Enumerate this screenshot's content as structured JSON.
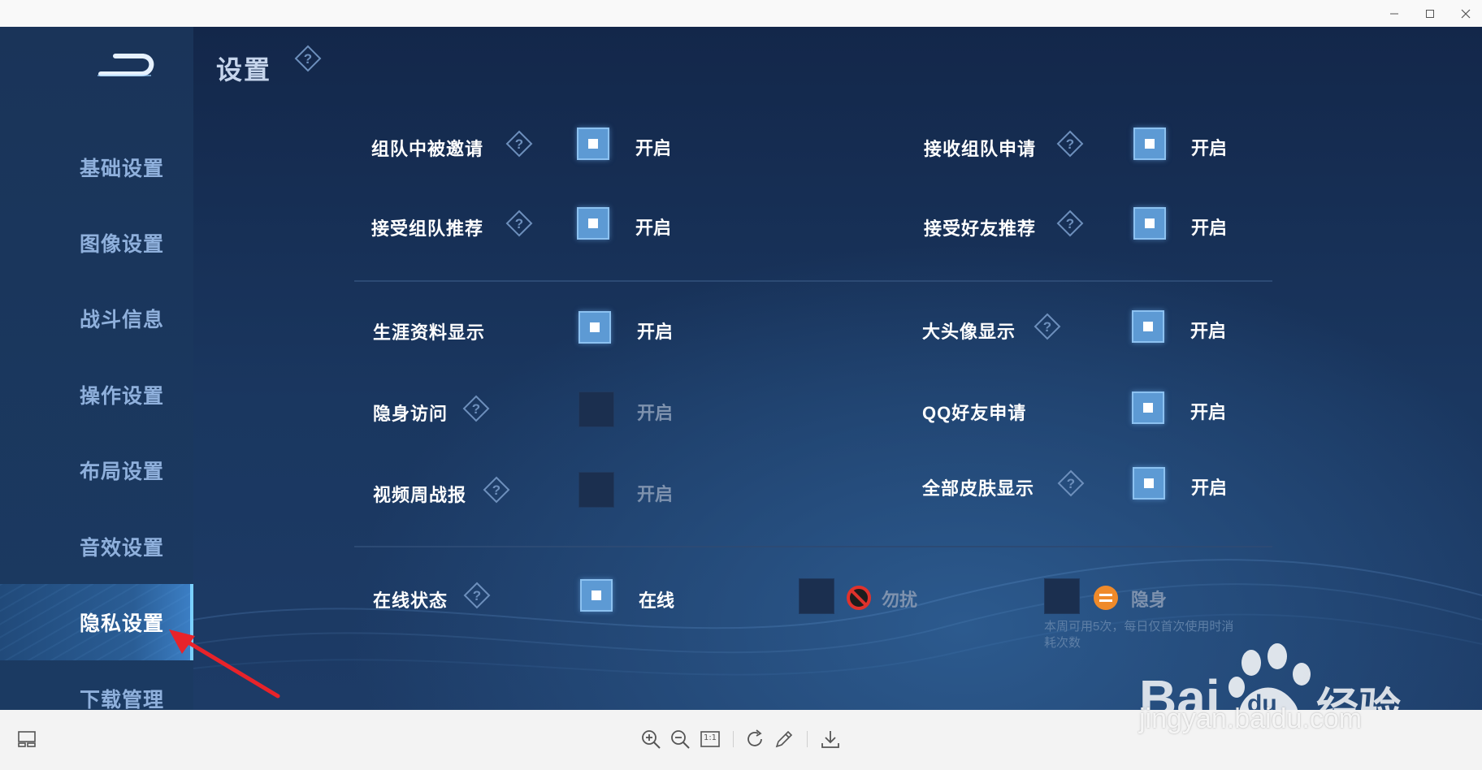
{
  "window": {
    "controls": [
      "minimize-icon",
      "maximize-icon",
      "close-icon"
    ]
  },
  "sidebar": {
    "back_icon": "back-icon",
    "items": [
      {
        "label": "基础设置",
        "active": false
      },
      {
        "label": "图像设置",
        "active": false
      },
      {
        "label": "战斗信息",
        "active": false
      },
      {
        "label": "操作设置",
        "active": false
      },
      {
        "label": "布局设置",
        "active": false
      },
      {
        "label": "音效设置",
        "active": false
      },
      {
        "label": "隐私设置",
        "active": true
      },
      {
        "label": "下载管理",
        "active": false
      }
    ]
  },
  "page": {
    "title": "设置"
  },
  "settings": {
    "team_invited": {
      "label": "组队中被邀请",
      "option": "开启",
      "checked": true
    },
    "receive_team_apply": {
      "label": "接收组队申请",
      "option": "开启",
      "checked": true
    },
    "accept_team_recommend": {
      "label": "接受组队推荐",
      "option": "开启",
      "checked": true
    },
    "accept_friend_recommend": {
      "label": "接受好友推荐",
      "option": "开启",
      "checked": true
    },
    "career_display": {
      "label": "生涯资料显示",
      "option": "开启",
      "checked": true
    },
    "big_avatar_display": {
      "label": "大头像显示",
      "option": "开启",
      "checked": true
    },
    "stealth_visit": {
      "label": "隐身访问",
      "option": "开启",
      "checked": false
    },
    "qq_friend_apply": {
      "label": "QQ好友申请",
      "option": "开启",
      "checked": true
    },
    "video_weekly_report": {
      "label": "视频周战报",
      "option": "开启",
      "checked": false
    },
    "all_skins_display": {
      "label": "全部皮肤显示",
      "option": "开启",
      "checked": true
    }
  },
  "online_status": {
    "label": "在线状态",
    "options": [
      {
        "label": "在线",
        "checked": true,
        "icon": ""
      },
      {
        "label": "勿扰",
        "checked": false,
        "icon": "no-disturb-icon"
      },
      {
        "label": "隐身",
        "checked": false,
        "icon": "invisible-icon"
      }
    ],
    "note": "本周可用5次，每日仅首次使用时消耗次数"
  },
  "watermark": {
    "brand_latin_1": "Bai",
    "brand_paw": "du",
    "brand_cn": "经验",
    "url": "jingyan.baidu.com"
  },
  "toolbar": {
    "left_icon": "thumbnail-panel-icon",
    "icons": [
      "zoom-in-icon",
      "zoom-out-icon",
      "actual-size-icon",
      "rotate-icon",
      "edit-icon",
      "download-icon"
    ],
    "actual_size_label": "1:1"
  },
  "colors": {
    "accent": "#5d9ad4",
    "active_nav": "#2a5d95",
    "background": "#1a3760",
    "annotation_arrow": "#e8232a"
  }
}
